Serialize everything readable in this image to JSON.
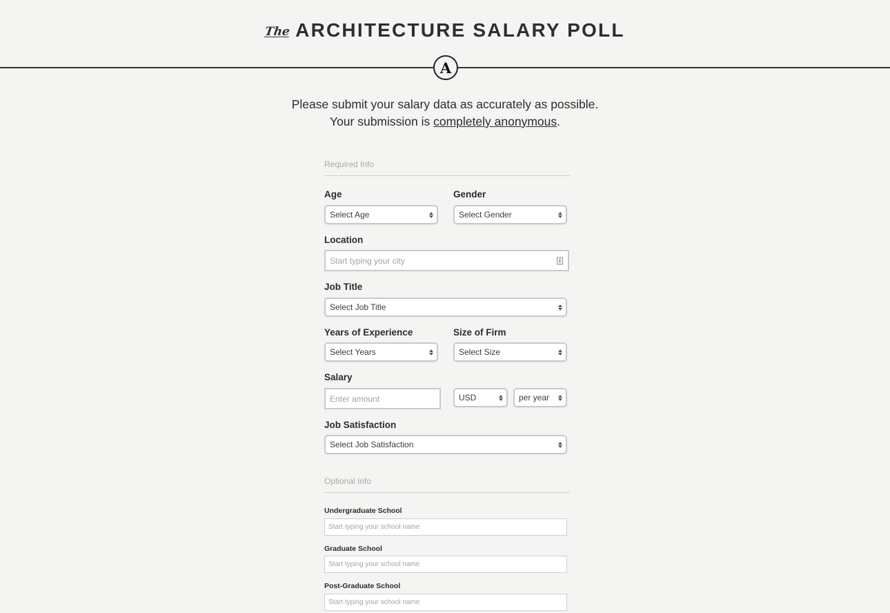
{
  "header": {
    "the": "The",
    "title": "ARCHITECTURE SALARY POLL",
    "logo_letter": "A"
  },
  "intro": {
    "line1": "Please submit your salary data as accurately as possible.",
    "line2_prefix": "Your submission is ",
    "line2_link": "completely anonymous",
    "line2_suffix": "."
  },
  "required": {
    "heading": "Required Info",
    "age": {
      "label": "Age",
      "value": "Select Age"
    },
    "gender": {
      "label": "Gender",
      "value": "Select Gender"
    },
    "location": {
      "label": "Location",
      "placeholder": "Start typing your city",
      "icon": "contact-card-icon"
    },
    "job_title": {
      "label": "Job Title",
      "value": "Select Job Title"
    },
    "years": {
      "label": "Years of Experience",
      "value": "Select Years"
    },
    "firm_size": {
      "label": "Size of Firm",
      "value": "Select Size"
    },
    "salary": {
      "label": "Salary",
      "placeholder": "Enter amount",
      "currency": "USD",
      "period": "per year"
    },
    "satisfaction": {
      "label": "Job Satisfaction",
      "value": "Select Job Satisfaction"
    }
  },
  "optional": {
    "heading": "Optional Info",
    "undergrad": {
      "label": "Undergraduate School",
      "placeholder": "Start typing your school name"
    },
    "grad": {
      "label": "Graduate School",
      "placeholder": "Start typing your school name"
    },
    "postgrad": {
      "label": "Post-Graduate School",
      "placeholder": "Start typing your school name"
    }
  }
}
